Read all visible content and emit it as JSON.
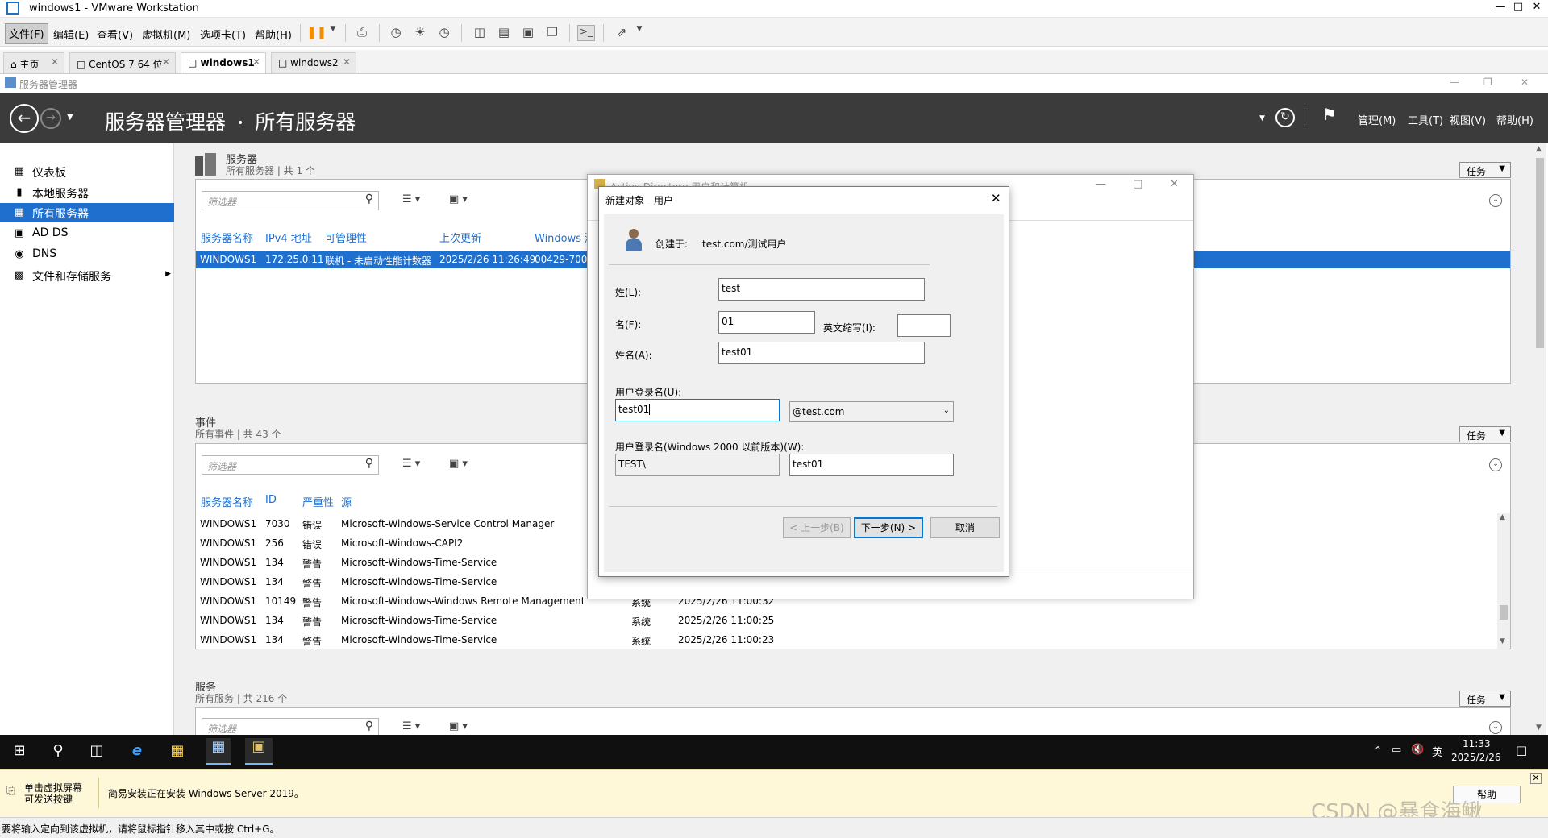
{
  "vmware": {
    "window_title": "windows1 - VMware Workstation",
    "menus": [
      "文件(F)",
      "编辑(E)",
      "查看(V)",
      "虚拟机(M)",
      "选项卡(T)",
      "帮助(H)"
    ],
    "tabs": [
      {
        "label": "主页"
      },
      {
        "label": "CentOS 7 64 位"
      },
      {
        "label": "windows1"
      },
      {
        "label": "windows2"
      }
    ],
    "help_button": "帮助",
    "hint_line1": "单击虚拟屏幕",
    "hint_line2": "可发送按键",
    "hint_message": "简易安装正在安装 Windows Server 2019。",
    "status_text": "要将输入定向到该虚拟机，请将鼠标指针移入其中或按 Ctrl+G。",
    "watermark": "CSDN @暴食海鳅"
  },
  "server_manager": {
    "window_title": "服务器管理器",
    "breadcrumb_root": "服务器管理器",
    "breadcrumb_sep": "•",
    "breadcrumb_page": "所有服务器",
    "header_menus": [
      "管理(M)",
      "工具(T)",
      "视图(V)",
      "帮助(H)"
    ],
    "sidebar": [
      {
        "label": "仪表板"
      },
      {
        "label": "本地服务器"
      },
      {
        "label": "所有服务器"
      },
      {
        "label": "AD DS"
      },
      {
        "label": "DNS"
      },
      {
        "label": "文件和存储服务"
      }
    ],
    "tasks_label": "任务",
    "filter_placeholder": "筛选器",
    "servers": {
      "title": "服务器",
      "subtitle": "所有服务器 | 共 1 个",
      "columns": [
        "服务器名称",
        "IPv4 地址",
        "可管理性",
        "上次更新",
        "Windows 激"
      ],
      "rows": [
        [
          "WINDOWS1",
          "172.25.0.11",
          "联机 - 未启动性能计数器",
          "2025/2/26 11:26:49",
          "00429-700"
        ]
      ]
    },
    "events": {
      "title": "事件",
      "subtitle": "所有事件 | 共 43 个",
      "columns": [
        "服务器名称",
        "ID",
        "严重性",
        "源"
      ],
      "rows": [
        [
          "WINDOWS1",
          "7030",
          "错误",
          "Microsoft-Windows-Service Control Manager",
          "",
          ""
        ],
        [
          "WINDOWS1",
          "256",
          "错误",
          "Microsoft-Windows-CAPI2",
          "",
          ""
        ],
        [
          "WINDOWS1",
          "134",
          "警告",
          "Microsoft-Windows-Time-Service",
          "",
          ""
        ],
        [
          "WINDOWS1",
          "134",
          "警告",
          "Microsoft-Windows-Time-Service",
          "",
          ""
        ],
        [
          "WINDOWS1",
          "10149",
          "警告",
          "Microsoft-Windows-Windows Remote Management",
          "系统",
          "2025/2/26 11:00:32"
        ],
        [
          "WINDOWS1",
          "134",
          "警告",
          "Microsoft-Windows-Time-Service",
          "系统",
          "2025/2/26 11:00:25"
        ],
        [
          "WINDOWS1",
          "134",
          "警告",
          "Microsoft-Windows-Time-Service",
          "系统",
          "2025/2/26 11:00:23"
        ]
      ]
    },
    "services": {
      "title": "服务",
      "subtitle": "所有服务 | 共 216 个"
    }
  },
  "ad_window": {
    "title": "Active Directory 用户和计算机"
  },
  "dialog": {
    "title": "新建对象 - 用户",
    "created_in_label": "创建于:",
    "created_in_value": "test.com/测试用户",
    "last_name_label": "姓(L):",
    "last_name_value": "test",
    "first_name_label": "名(F):",
    "first_name_value": "01",
    "initials_label": "英文缩写(I):",
    "initials_value": "",
    "full_name_label": "姓名(A):",
    "full_name_value": "test01",
    "logon_label": "用户登录名(U):",
    "logon_value": "test01",
    "domain_value": "@test.com",
    "pre2000_label": "用户登录名(Windows 2000 以前版本)(W):",
    "pre2000_domain": "TEST\\",
    "pre2000_user": "test01",
    "back_button": "< 上一步(B)",
    "next_button": "下一步(N) >",
    "cancel_button": "取消"
  },
  "taskbar": {
    "ime": "英",
    "time": "11:33",
    "date": "2025/2/26"
  }
}
